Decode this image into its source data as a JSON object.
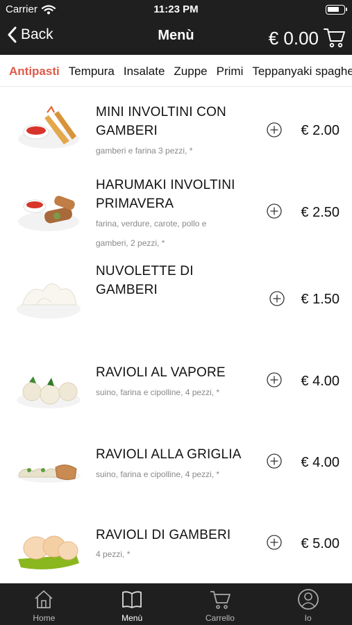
{
  "status_bar": {
    "carrier": "Carrier",
    "time": "11:23 PM"
  },
  "nav": {
    "back_label": "Back",
    "title": "Menù",
    "cart_total": "€ 0.00"
  },
  "categories": [
    {
      "label": "Antipasti",
      "active": true
    },
    {
      "label": "Tempura",
      "active": false
    },
    {
      "label": "Insalate",
      "active": false
    },
    {
      "label": "Zuppe",
      "active": false
    },
    {
      "label": "Primi",
      "active": false
    },
    {
      "label": "Teppanyaki spaghetti",
      "active": false
    }
  ],
  "items": [
    {
      "name_lines": [
        "MINI INVOLTINI CON",
        "GAMBERI"
      ],
      "desc_lines": [
        "gamberi e farina 3 pezzi, *"
      ],
      "price": "€ 2.00"
    },
    {
      "name_lines": [
        "HARUMAKI INVOLTINI",
        "PRIMAVERA"
      ],
      "desc_lines": [
        "farina, verdure, carote, pollo e",
        "gamberi, 2 pezzi, *"
      ],
      "price": "€ 2.50"
    },
    {
      "name_lines": [
        "NUVOLETTE DI",
        "GAMBERI"
      ],
      "desc_lines": [],
      "price": "€ 1.50"
    },
    {
      "name_lines": [
        "RAVIOLI AL VAPORE"
      ],
      "desc_lines": [
        "suino, farina e cipolline, 4 pezzi, *"
      ],
      "price": "€ 4.00"
    },
    {
      "name_lines": [
        "RAVIOLI ALLA GRIGLIA"
      ],
      "desc_lines": [
        "suino, farina e cipolline, 4 pezzi, *"
      ],
      "price": "€ 4.00"
    },
    {
      "name_lines": [
        "RAVIOLI DI GAMBERI"
      ],
      "desc_lines": [
        "4 pezzi, *"
      ],
      "price": "€ 5.00"
    }
  ],
  "tabbar": [
    {
      "label": "Home",
      "icon": "home-icon",
      "active": false
    },
    {
      "label": "Menù",
      "icon": "book-icon",
      "active": true
    },
    {
      "label": "Carrello",
      "icon": "cart-icon",
      "active": false
    },
    {
      "label": "Io",
      "icon": "user-icon",
      "active": false
    }
  ],
  "colors": {
    "bar_bg": "#1f1f1f",
    "accent": "#e05a4a",
    "muted_text": "#888888"
  }
}
